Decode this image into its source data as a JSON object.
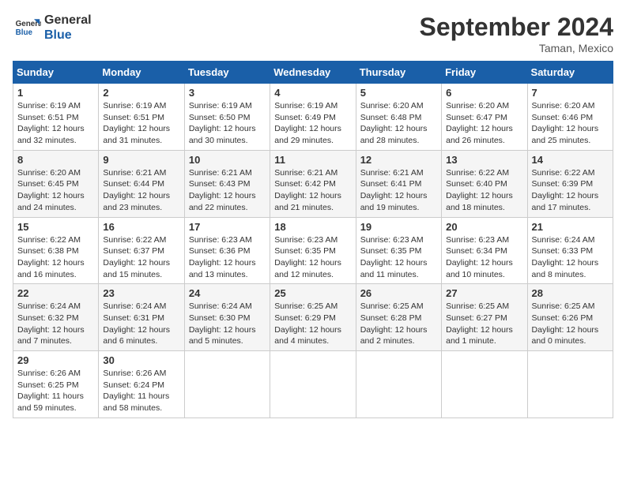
{
  "header": {
    "logo_line1": "General",
    "logo_line2": "Blue",
    "month": "September 2024",
    "location": "Taman, Mexico"
  },
  "days_of_week": [
    "Sunday",
    "Monday",
    "Tuesday",
    "Wednesday",
    "Thursday",
    "Friday",
    "Saturday"
  ],
  "weeks": [
    [
      {
        "day": "1",
        "info": "Sunrise: 6:19 AM\nSunset: 6:51 PM\nDaylight: 12 hours\nand 32 minutes."
      },
      {
        "day": "2",
        "info": "Sunrise: 6:19 AM\nSunset: 6:51 PM\nDaylight: 12 hours\nand 31 minutes."
      },
      {
        "day": "3",
        "info": "Sunrise: 6:19 AM\nSunset: 6:50 PM\nDaylight: 12 hours\nand 30 minutes."
      },
      {
        "day": "4",
        "info": "Sunrise: 6:19 AM\nSunset: 6:49 PM\nDaylight: 12 hours\nand 29 minutes."
      },
      {
        "day": "5",
        "info": "Sunrise: 6:20 AM\nSunset: 6:48 PM\nDaylight: 12 hours\nand 28 minutes."
      },
      {
        "day": "6",
        "info": "Sunrise: 6:20 AM\nSunset: 6:47 PM\nDaylight: 12 hours\nand 26 minutes."
      },
      {
        "day": "7",
        "info": "Sunrise: 6:20 AM\nSunset: 6:46 PM\nDaylight: 12 hours\nand 25 minutes."
      }
    ],
    [
      {
        "day": "8",
        "info": "Sunrise: 6:20 AM\nSunset: 6:45 PM\nDaylight: 12 hours\nand 24 minutes."
      },
      {
        "day": "9",
        "info": "Sunrise: 6:21 AM\nSunset: 6:44 PM\nDaylight: 12 hours\nand 23 minutes."
      },
      {
        "day": "10",
        "info": "Sunrise: 6:21 AM\nSunset: 6:43 PM\nDaylight: 12 hours\nand 22 minutes."
      },
      {
        "day": "11",
        "info": "Sunrise: 6:21 AM\nSunset: 6:42 PM\nDaylight: 12 hours\nand 21 minutes."
      },
      {
        "day": "12",
        "info": "Sunrise: 6:21 AM\nSunset: 6:41 PM\nDaylight: 12 hours\nand 19 minutes."
      },
      {
        "day": "13",
        "info": "Sunrise: 6:22 AM\nSunset: 6:40 PM\nDaylight: 12 hours\nand 18 minutes."
      },
      {
        "day": "14",
        "info": "Sunrise: 6:22 AM\nSunset: 6:39 PM\nDaylight: 12 hours\nand 17 minutes."
      }
    ],
    [
      {
        "day": "15",
        "info": "Sunrise: 6:22 AM\nSunset: 6:38 PM\nDaylight: 12 hours\nand 16 minutes."
      },
      {
        "day": "16",
        "info": "Sunrise: 6:22 AM\nSunset: 6:37 PM\nDaylight: 12 hours\nand 15 minutes."
      },
      {
        "day": "17",
        "info": "Sunrise: 6:23 AM\nSunset: 6:36 PM\nDaylight: 12 hours\nand 13 minutes."
      },
      {
        "day": "18",
        "info": "Sunrise: 6:23 AM\nSunset: 6:35 PM\nDaylight: 12 hours\nand 12 minutes."
      },
      {
        "day": "19",
        "info": "Sunrise: 6:23 AM\nSunset: 6:35 PM\nDaylight: 12 hours\nand 11 minutes."
      },
      {
        "day": "20",
        "info": "Sunrise: 6:23 AM\nSunset: 6:34 PM\nDaylight: 12 hours\nand 10 minutes."
      },
      {
        "day": "21",
        "info": "Sunrise: 6:24 AM\nSunset: 6:33 PM\nDaylight: 12 hours\nand 8 minutes."
      }
    ],
    [
      {
        "day": "22",
        "info": "Sunrise: 6:24 AM\nSunset: 6:32 PM\nDaylight: 12 hours\nand 7 minutes."
      },
      {
        "day": "23",
        "info": "Sunrise: 6:24 AM\nSunset: 6:31 PM\nDaylight: 12 hours\nand 6 minutes."
      },
      {
        "day": "24",
        "info": "Sunrise: 6:24 AM\nSunset: 6:30 PM\nDaylight: 12 hours\nand 5 minutes."
      },
      {
        "day": "25",
        "info": "Sunrise: 6:25 AM\nSunset: 6:29 PM\nDaylight: 12 hours\nand 4 minutes."
      },
      {
        "day": "26",
        "info": "Sunrise: 6:25 AM\nSunset: 6:28 PM\nDaylight: 12 hours\nand 2 minutes."
      },
      {
        "day": "27",
        "info": "Sunrise: 6:25 AM\nSunset: 6:27 PM\nDaylight: 12 hours\nand 1 minute."
      },
      {
        "day": "28",
        "info": "Sunrise: 6:25 AM\nSunset: 6:26 PM\nDaylight: 12 hours\nand 0 minutes."
      }
    ],
    [
      {
        "day": "29",
        "info": "Sunrise: 6:26 AM\nSunset: 6:25 PM\nDaylight: 11 hours\nand 59 minutes."
      },
      {
        "day": "30",
        "info": "Sunrise: 6:26 AM\nSunset: 6:24 PM\nDaylight: 11 hours\nand 58 minutes."
      },
      {
        "day": "",
        "info": ""
      },
      {
        "day": "",
        "info": ""
      },
      {
        "day": "",
        "info": ""
      },
      {
        "day": "",
        "info": ""
      },
      {
        "day": "",
        "info": ""
      }
    ]
  ]
}
